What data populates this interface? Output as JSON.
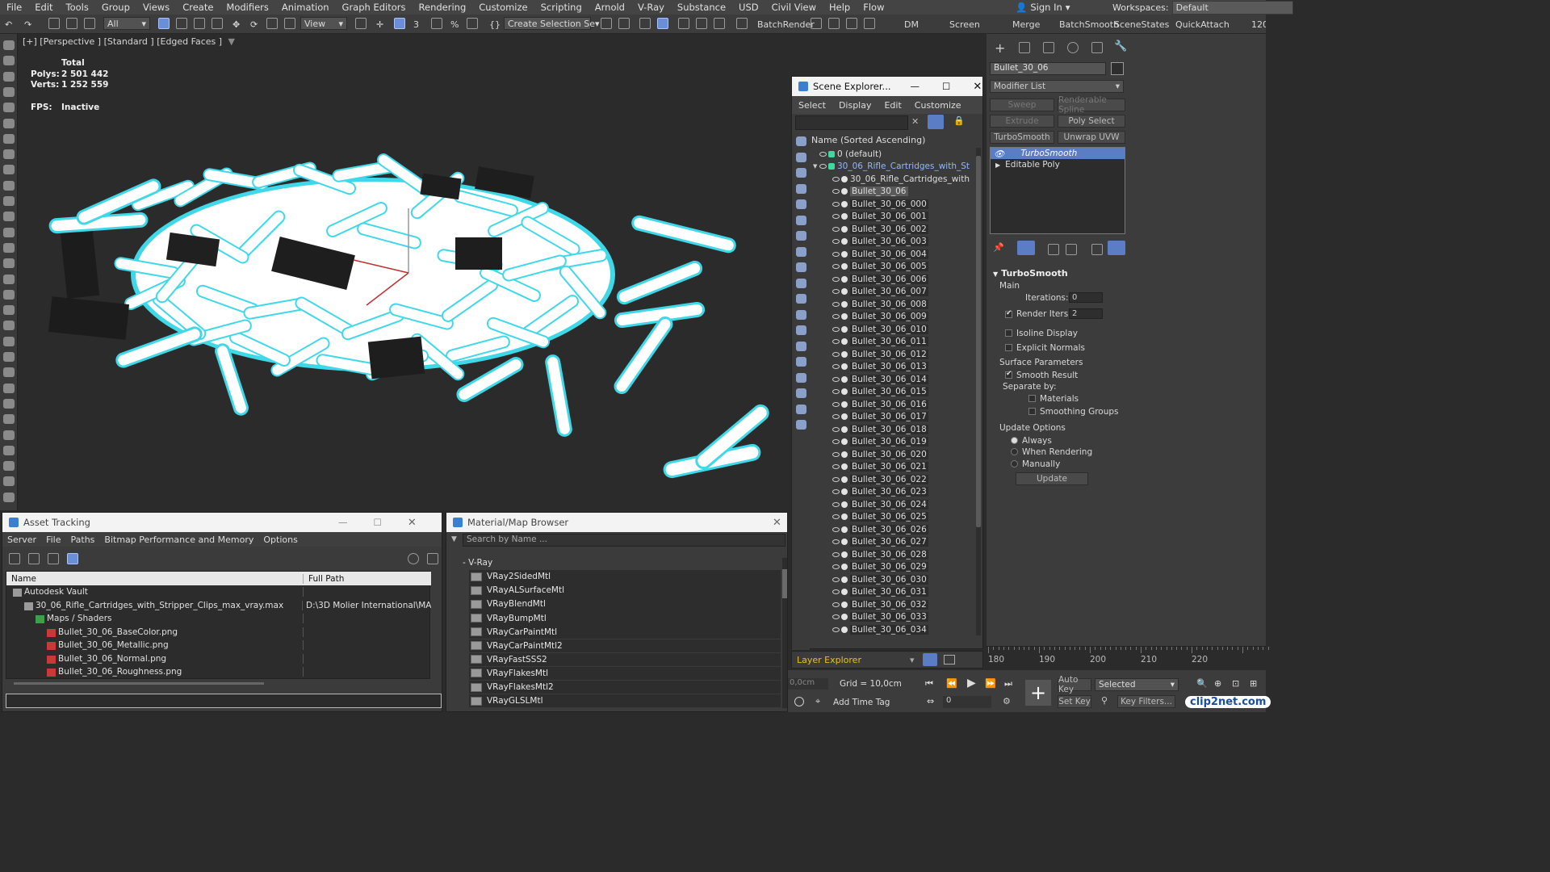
{
  "menubar": {
    "items": [
      "File",
      "Edit",
      "Tools",
      "Group",
      "Views",
      "Create",
      "Modifiers",
      "Animation",
      "Graph Editors",
      "Rendering",
      "Customize",
      "Scripting",
      "Arnold",
      "V-Ray",
      "Substance",
      "USD",
      "Civil View",
      "Help",
      "Flow"
    ],
    "sign_in": "Sign In",
    "workspaces_label": "Workspaces:",
    "workspaces_value": "Default"
  },
  "toolbar": {
    "filter": "All",
    "ref_coord": "View",
    "selection_set": "Create Selection Se",
    "batchrender": "BatchRender",
    "dm": "DM",
    "screen": "Screen",
    "merge": "Merge",
    "batchsmooth": "BatchSmooth",
    "scenestates": "SceneStates",
    "quickattach": "QuickAttach",
    "ruler": "120"
  },
  "viewport": {
    "label": "[+] [Perspective ] [Standard ] [Edged Faces ]",
    "stats": {
      "total_label": "Total",
      "polys_label": "Polys:",
      "polys": "2 501 442",
      "verts_label": "Verts:",
      "verts": "1 252 559",
      "fps_label": "FPS:",
      "fps": "Inactive"
    }
  },
  "scene_explorer": {
    "title": "Scene Explorer...",
    "menu": [
      "Select",
      "Display",
      "Edit",
      "Customize"
    ],
    "header": "Name (Sorted Ascending)",
    "default_layer": "0 (default)",
    "group": "30_06_Rifle_Cartridges_with_St",
    "subgroup": "30_06_Rifle_Cartridges_with",
    "items": [
      "Bullet_30_06",
      "Bullet_30_06_000",
      "Bullet_30_06_001",
      "Bullet_30_06_002",
      "Bullet_30_06_003",
      "Bullet_30_06_004",
      "Bullet_30_06_005",
      "Bullet_30_06_006",
      "Bullet_30_06_007",
      "Bullet_30_06_008",
      "Bullet_30_06_009",
      "Bullet_30_06_010",
      "Bullet_30_06_011",
      "Bullet_30_06_012",
      "Bullet_30_06_013",
      "Bullet_30_06_014",
      "Bullet_30_06_015",
      "Bullet_30_06_016",
      "Bullet_30_06_017",
      "Bullet_30_06_018",
      "Bullet_30_06_019",
      "Bullet_30_06_020",
      "Bullet_30_06_021",
      "Bullet_30_06_022",
      "Bullet_30_06_023",
      "Bullet_30_06_024",
      "Bullet_30_06_025",
      "Bullet_30_06_026",
      "Bullet_30_06_027",
      "Bullet_30_06_028",
      "Bullet_30_06_029",
      "Bullet_30_06_030",
      "Bullet_30_06_031",
      "Bullet_30_06_032",
      "Bullet_30_06_033",
      "Bullet_30_06_034"
    ],
    "layer_explorer": "Layer Explorer"
  },
  "command_panel": {
    "object_name": "Bullet_30_06",
    "modifier_list": "Modifier List",
    "buttons": [
      "Sweep",
      "Renderable Spline",
      "Extrude",
      "Poly Select",
      "TurboSmooth",
      "Unwrap UVW"
    ],
    "stack": [
      "TurboSmooth",
      "Editable Poly"
    ],
    "rollout_title": "TurboSmooth",
    "main_label": "Main",
    "iterations_label": "Iterations:",
    "iterations": "0",
    "render_iters_label": "Render Iters:",
    "render_iters": "2",
    "isoline": "Isoline Display",
    "explicit": "Explicit Normals",
    "surface_params": "Surface Parameters",
    "smooth_result": "Smooth Result",
    "separate_by": "Separate by:",
    "materials": "Materials",
    "smoothing_groups": "Smoothing Groups",
    "update_options": "Update Options",
    "always": "Always",
    "when_rendering": "When Rendering",
    "manually": "Manually",
    "update": "Update"
  },
  "asset_tracking": {
    "title": "Asset Tracking",
    "menu": [
      "Server",
      "File",
      "Paths",
      "Bitmap Performance and Memory",
      "Options"
    ],
    "col_name": "Name",
    "col_path": "Full Path",
    "rows": [
      {
        "name": "Autodesk Vault",
        "path": "",
        "indent": 1
      },
      {
        "name": "30_06_Rifle_Cartridges_with_Stripper_Clips_max_vray.max",
        "path": "D:\\3D Molier International\\MA",
        "indent": 2
      },
      {
        "name": "Maps / Shaders",
        "path": "",
        "indent": 3
      },
      {
        "name": "Bullet_30_06_BaseColor.png",
        "path": "",
        "indent": 4
      },
      {
        "name": "Bullet_30_06_Metallic.png",
        "path": "",
        "indent": 4
      },
      {
        "name": "Bullet_30_06_Normal.png",
        "path": "",
        "indent": 4
      },
      {
        "name": "Bullet_30_06_Roughness.png",
        "path": "",
        "indent": 4
      }
    ]
  },
  "material_browser": {
    "title": "Material/Map Browser",
    "search_placeholder": "Search by Name ...",
    "group": "- V-Ray",
    "items": [
      "VRay2SidedMtl",
      "VRayALSurfaceMtl",
      "VRayBlendMtl",
      "VRayBumpMtl",
      "VRayCarPaintMtl",
      "VRayCarPaintMtl2",
      "VRayFastSSS2",
      "VRayFlakesMtl",
      "VRayFlakesMtl2",
      "VRayGLSLMtl"
    ]
  },
  "timeline": {
    "ticks": [
      "180",
      "190",
      "200",
      "210",
      "220"
    ]
  },
  "bottom": {
    "grid": "Grid = 10,0cm",
    "coord": "0,0cm",
    "add_time_tag": "Add Time Tag",
    "frame": "0",
    "auto_key": "Auto Key",
    "set_key": "Set Key",
    "selected": "Selected",
    "key_filters": "Key Filters...",
    "watermark": "clip2net.com"
  },
  "colors": {
    "highlight": "#5b7dc6",
    "selection_glow": "#3fd8e8"
  }
}
